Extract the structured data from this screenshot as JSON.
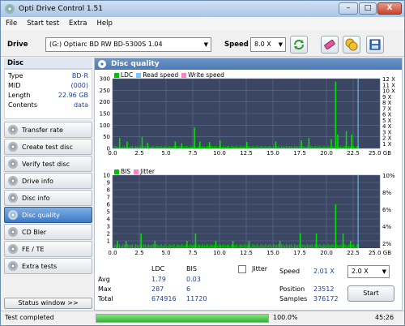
{
  "window": {
    "title": "Opti Drive Control 1.51",
    "min": "–",
    "max": "□",
    "close": "X"
  },
  "menu": [
    "File",
    "Start test",
    "Extra",
    "Help"
  ],
  "toolbar": {
    "drive_label": "Drive",
    "drive_value": "(G:)  Optiarc BD RW BD-5300S 1.04",
    "speed_label": "Speed",
    "speed_value": "8.0 X"
  },
  "disc": {
    "header": "Disc",
    "fields": [
      {
        "k": "Type",
        "v": "BD-R"
      },
      {
        "k": "MID",
        "v": "(000)"
      },
      {
        "k": "Length",
        "v": "22.96 GB"
      },
      {
        "k": "Contents",
        "v": "data"
      }
    ]
  },
  "nav": [
    {
      "label": "Transfer rate",
      "active": false
    },
    {
      "label": "Create test disc",
      "active": false
    },
    {
      "label": "Verify test disc",
      "active": false
    },
    {
      "label": "Drive info",
      "active": false
    },
    {
      "label": "Disc info",
      "active": false
    },
    {
      "label": "Disc quality",
      "active": true
    },
    {
      "label": "CD Bler",
      "active": false
    },
    {
      "label": "FE / TE",
      "active": false
    },
    {
      "label": "Extra tests",
      "active": false
    }
  ],
  "status_window_button": "Status window >>",
  "panel_title": "Disc quality",
  "chart_data": [
    {
      "type": "bar",
      "legend": [
        "LDC",
        "Read speed",
        "Write speed"
      ],
      "legend_colors": [
        "#00c000",
        "#7fc6ff",
        "#ff80c0"
      ],
      "x_ticks": [
        "0.0",
        "2.5",
        "5.0",
        "7.5",
        "10.0",
        "12.5",
        "15.0",
        "17.5",
        "20.0",
        "22.5",
        "25.0 GB"
      ],
      "y_left_ticks": [
        "300",
        "250",
        "200",
        "150",
        "100",
        "50",
        "0"
      ],
      "y_right_ticks": [
        "12 X",
        "11 X",
        "10 X",
        "9 X",
        "8 X",
        "7 X",
        "6 X",
        "5 X",
        "4 X",
        "3 X",
        "2 X",
        "1 X"
      ],
      "xlim": [
        0,
        25
      ],
      "ylim": [
        0,
        300
      ],
      "disc_end": 22.96,
      "baseline": 8,
      "spikes": [
        [
          0.6,
          45
        ],
        [
          1.3,
          30
        ],
        [
          2.7,
          50
        ],
        [
          3.2,
          25
        ],
        [
          5.8,
          30
        ],
        [
          6.4,
          22
        ],
        [
          7.6,
          90
        ],
        [
          8.1,
          30
        ],
        [
          9.0,
          28
        ],
        [
          10.0,
          35
        ],
        [
          12.5,
          28
        ],
        [
          15.2,
          30
        ],
        [
          17.6,
          35
        ],
        [
          18.3,
          45
        ],
        [
          20.4,
          40
        ],
        [
          20.8,
          287
        ],
        [
          21.0,
          60
        ],
        [
          21.8,
          75
        ],
        [
          22.3,
          60
        ]
      ]
    },
    {
      "type": "bar",
      "legend": [
        "BIS",
        "Jitter"
      ],
      "legend_colors": [
        "#00c000",
        "#ff80c0"
      ],
      "x_ticks": [
        "0.0",
        "2.5",
        "5.0",
        "7.5",
        "10.0",
        "12.5",
        "15.0",
        "17.5",
        "20.0",
        "22.5",
        "25.0 GB"
      ],
      "y_left_ticks": [
        "10",
        "9",
        "8",
        "7",
        "6",
        "5",
        "4",
        "3",
        "2",
        "1"
      ],
      "y_right_ticks": [
        "10%",
        "8%",
        "6%",
        "4%",
        "2%"
      ],
      "xlim": [
        0,
        25
      ],
      "ylim": [
        0,
        10
      ],
      "disc_end": 22.96,
      "baseline": 0.4,
      "spikes": [
        [
          0.4,
          1
        ],
        [
          1.2,
          1
        ],
        [
          2.6,
          2
        ],
        [
          3.9,
          1
        ],
        [
          6.9,
          1
        ],
        [
          7.7,
          2
        ],
        [
          9.6,
          1
        ],
        [
          11.2,
          1
        ],
        [
          12.7,
          1
        ],
        [
          15.6,
          1
        ],
        [
          17.5,
          2
        ],
        [
          19.0,
          2
        ],
        [
          20.8,
          6
        ],
        [
          21.5,
          2
        ],
        [
          22.2,
          1
        ]
      ]
    }
  ],
  "stats": {
    "col_ldc": "LDC",
    "col_bis": "BIS",
    "rows": [
      {
        "label": "Avg",
        "ldc": "1.79",
        "bis": "0.03"
      },
      {
        "label": "Max",
        "ldc": "287",
        "bis": "6"
      },
      {
        "label": "Total",
        "ldc": "674916",
        "bis": "11720"
      }
    ],
    "jitter_label": "Jitter",
    "speed_label": "Speed",
    "speed_value": "2.01 X",
    "speed_select": "2.0 X",
    "position_label": "Position",
    "position_value": "23512",
    "samples_label": "Samples",
    "samples_value": "376172",
    "start_button": "Start"
  },
  "statusbar": {
    "text": "Test completed",
    "progress": 100,
    "progress_text": "100.0%",
    "time": "45:26"
  }
}
